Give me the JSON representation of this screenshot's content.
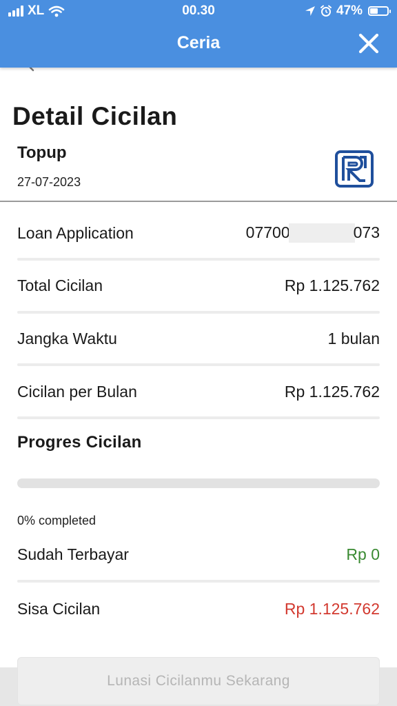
{
  "status_bar": {
    "carrier": "XL",
    "time": "00.30",
    "battery": "47%",
    "battery_level": 0.47
  },
  "app_bar": {
    "title": "Ceria",
    "close_icon": "close-icon"
  },
  "page": {
    "title": "Detail Cicilan",
    "product_name": "Topup",
    "date": "27-07-2023",
    "bank_logo": "bri-bank-logo"
  },
  "details": {
    "loan_application": {
      "label": "Loan Application",
      "value_prefix": "07700",
      "value_suffix": "073"
    },
    "total_cicilan": {
      "label": "Total Cicilan",
      "value": "Rp 1.125.762"
    },
    "jangka_waktu": {
      "label": "Jangka Waktu",
      "value": "1 bulan"
    },
    "cicilan_per_bulan": {
      "label": "Cicilan per Bulan",
      "value": "Rp 1.125.762"
    }
  },
  "progress": {
    "section_title": "Progres Cicilan",
    "percent": 0,
    "completed_text": "0% completed",
    "paid": {
      "label": "Sudah Terbayar",
      "value": "Rp 0"
    },
    "remaining": {
      "label": "Sisa Cicilan",
      "value": "Rp 1.125.762"
    }
  },
  "cta": {
    "label": "Lunasi Cicilanmu Sekarang"
  },
  "colors": {
    "primary": "#4a8fe0",
    "paid_green": "#3a8a32",
    "remaining_red": "#d2392f",
    "disabled_text": "#b5b5b5"
  }
}
